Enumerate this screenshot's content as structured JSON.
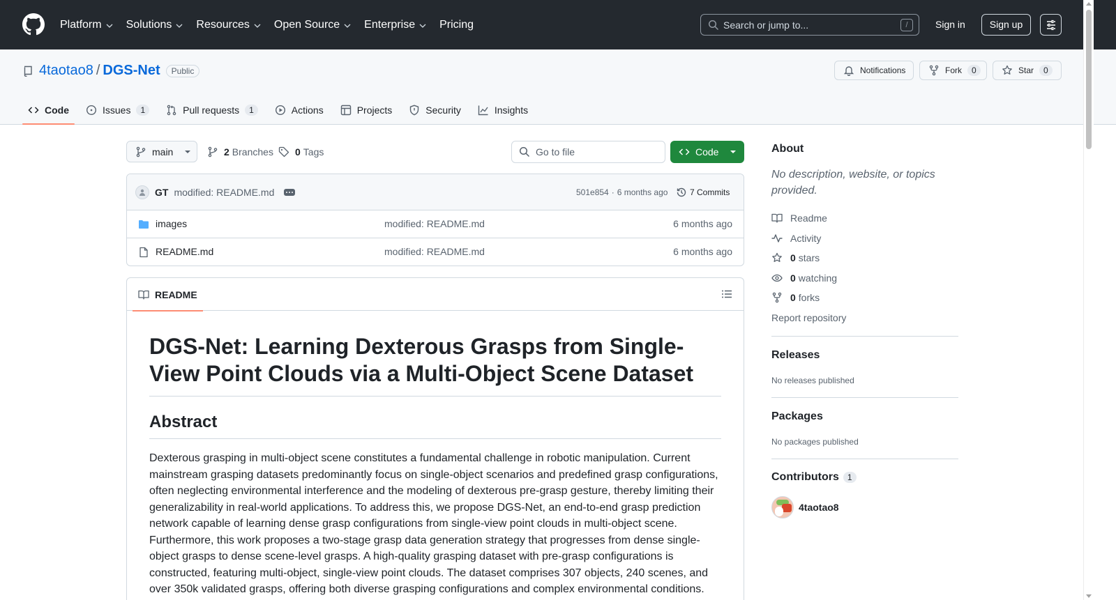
{
  "header": {
    "nav": [
      {
        "label": "Platform"
      },
      {
        "label": "Solutions"
      },
      {
        "label": "Resources"
      },
      {
        "label": "Open Source"
      },
      {
        "label": "Enterprise"
      },
      {
        "label": "Pricing"
      }
    ],
    "search_placeholder": "Search or jump to...",
    "search_shortcut": "/",
    "sign_in": "Sign in",
    "sign_up": "Sign up"
  },
  "repo": {
    "owner": "4taotao8",
    "separator": "/",
    "name": "DGS-Net",
    "visibility": "Public",
    "notifications_label": "Notifications",
    "fork_label": "Fork",
    "fork_count": "0",
    "star_label": "Star",
    "star_count": "0"
  },
  "tabs": [
    {
      "label": "Code",
      "icon": "code-icon"
    },
    {
      "label": "Issues",
      "count": "1",
      "icon": "issue-opened-icon"
    },
    {
      "label": "Pull requests",
      "count": "1",
      "icon": "git-pull-request-icon"
    },
    {
      "label": "Actions",
      "icon": "play-icon"
    },
    {
      "label": "Projects",
      "icon": "table-icon"
    },
    {
      "label": "Security",
      "icon": "shield-icon"
    },
    {
      "label": "Insights",
      "icon": "graph-icon"
    }
  ],
  "controls": {
    "branch": "main",
    "branches_count": "2",
    "branches_label": "Branches",
    "tags_count": "0",
    "tags_label": "Tags",
    "goto_placeholder": "Go to file",
    "code_button": "Code"
  },
  "latest_commit": {
    "author": "GT",
    "message": "modified: README.md",
    "sha": "501e854",
    "dot": "·",
    "age": "6 months ago",
    "commits_label": "7 Commits"
  },
  "files": [
    {
      "name": "images",
      "type": "folder",
      "message": "modified: README.md",
      "age": "6 months ago"
    },
    {
      "name": "README.md",
      "type": "file",
      "message": "modified: README.md",
      "age": "6 months ago"
    }
  ],
  "readme": {
    "tab_label": "README",
    "title": "DGS-Net: Learning Dexterous Grasps from Single-View Point Clouds via a Multi-Object Scene Dataset",
    "abstract_heading": "Abstract",
    "abstract": "Dexterous grasping in multi-object scene constitutes a fundamental challenge in robotic manipulation. Current mainstream grasping datasets predominantly focus on single-object scenarios and predefined grasp configurations, often neglecting environmental interference and the modeling of dexterous pre-grasp gesture, thereby limiting their generalizability in real-world applications. To address this, we propose DGS-Net, an end-to-end grasp prediction network capable of learning dense grasp configurations from single-view point clouds in multi-object scene. Furthermore, this work proposes a two-stage grasp data generation strategy that progresses from dense single-object grasps to dense scene-level grasps. A high-quality grasping dataset with pre-grasp configurations is constructed, featuring multi-object, single-view point clouds. The dataset comprises 307 objects, 240 scenes, and over 350k validated grasps, offering both diverse grasping configurations and complex environmental conditions. Experimental"
  },
  "sidebar": {
    "about_heading": "About",
    "about_desc": "No description, website, or topics provided.",
    "links": [
      {
        "label": "Readme",
        "icon": "book-icon"
      },
      {
        "label": "Activity",
        "icon": "pulse-icon"
      },
      {
        "count": "0",
        "label": "stars",
        "icon": "star-icon"
      },
      {
        "count": "0",
        "label": "watching",
        "icon": "eye-icon"
      },
      {
        "count": "0",
        "label": "forks",
        "icon": "repo-forked-icon"
      }
    ],
    "report": "Report repository",
    "releases_heading": "Releases",
    "releases_empty": "No releases published",
    "packages_heading": "Packages",
    "packages_empty": "No packages published",
    "contributors_heading": "Contributors",
    "contributors_count": "1",
    "contributor_name": "4taotao8"
  },
  "colors": {
    "header_bg": "#24292f",
    "link": "#0969da",
    "primary_button": "#1f883d",
    "tab_underline": "#fd8c73"
  }
}
